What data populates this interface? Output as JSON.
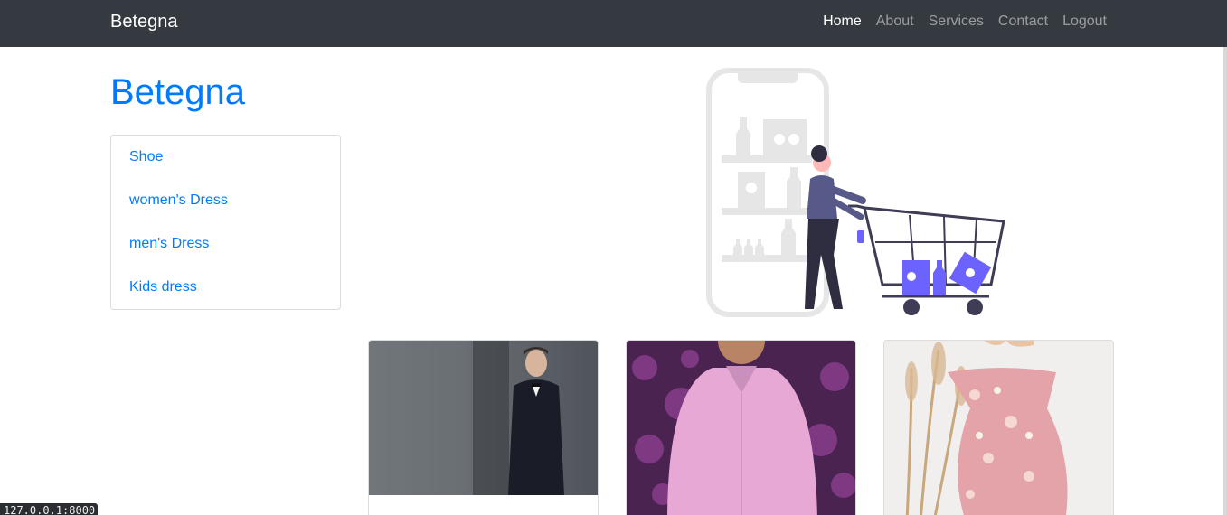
{
  "navbar": {
    "brand": "Betegna",
    "links": [
      {
        "label": "Home",
        "active": true
      },
      {
        "label": "About",
        "active": false
      },
      {
        "label": "Services",
        "active": false
      },
      {
        "label": "Contact",
        "active": false
      },
      {
        "label": "Logout",
        "active": false
      }
    ]
  },
  "sidebar": {
    "title": "Betegna",
    "categories": [
      "Shoe",
      "women's Dress",
      "men's Dress",
      "Kids dress"
    ]
  },
  "hero": {
    "icon": "shopping-cart-illustration"
  },
  "products": [
    {
      "image": "man-in-tuxedo-photo"
    },
    {
      "image": "man-in-pink-shirt-photo"
    },
    {
      "image": "floral-off-shoulder-dress-photo"
    }
  ],
  "status_bar": {
    "text": "127.0.0.1:8000"
  },
  "colors": {
    "navbar": "#343a40",
    "link": "#007bff",
    "accent": "#6c63ff"
  }
}
